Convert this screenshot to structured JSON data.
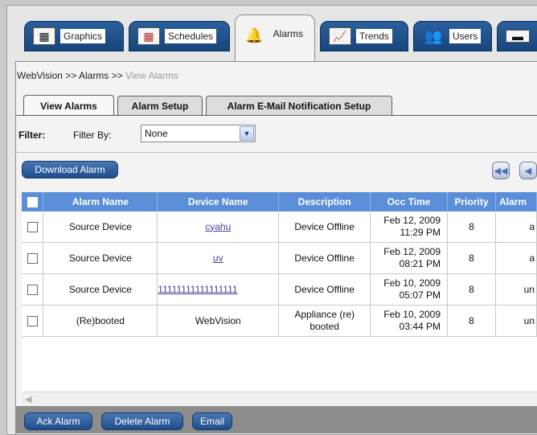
{
  "main_tabs": [
    {
      "label": "Graphics",
      "icon": "graphics-icon"
    },
    {
      "label": "Schedules",
      "icon": "calendar-icon"
    },
    {
      "label": "Alarms",
      "icon": "bell-icon"
    },
    {
      "label": "Trends",
      "icon": "trend-chart-icon"
    },
    {
      "label": "Users",
      "icon": "users-icon"
    },
    {
      "label": "",
      "icon": "appliance-icon"
    }
  ],
  "breadcrumb": {
    "root": "WebVision",
    "sep1": ">>",
    "section": "Alarms",
    "sep2": ">>",
    "current": "View Alarms"
  },
  "sub_tabs": [
    "View Alarms",
    "Alarm Setup",
    "Alarm E-Mail Notification Setup"
  ],
  "filter": {
    "label": "Filter:",
    "by_label": "Filter By:",
    "selected": "None"
  },
  "download_button": "Download Alarm",
  "table": {
    "headers": [
      "Alarm Name",
      "Device Name",
      "Description",
      "Occ Time",
      "Priority",
      "Alarm"
    ],
    "rows": [
      {
        "alarm_name": "Source Device",
        "device_name": "cyahu",
        "device_link": true,
        "description": "Device Offline",
        "occ_date": "Feb 12, 2009",
        "occ_time": "11:29 PM",
        "priority": "8",
        "status": "a"
      },
      {
        "alarm_name": "Source Device",
        "device_name": "uv",
        "device_link": true,
        "description": "Device Offline",
        "occ_date": "Feb 12, 2009",
        "occ_time": "08:21 PM",
        "priority": "8",
        "status": "a"
      },
      {
        "alarm_name": "Source Device",
        "device_name": "11111111111111111",
        "device_link": true,
        "description": "Device Offline",
        "occ_date": "Feb 10, 2009",
        "occ_time": "05:07 PM",
        "priority": "8",
        "status": "un"
      },
      {
        "alarm_name": "(Re)booted",
        "device_name": "WebVision",
        "device_link": false,
        "description": "Appliance (re) booted",
        "occ_date": "Feb 10, 2009",
        "occ_time": "03:44 PM",
        "priority": "8",
        "status": "un"
      }
    ]
  },
  "bottom_buttons": [
    "Ack Alarm",
    "Delete Alarm",
    "Email"
  ],
  "colors": {
    "tab_blue": "#1f4f8c",
    "header_blue": "#5b8ed8",
    "link_purple": "#4a3a9a"
  }
}
